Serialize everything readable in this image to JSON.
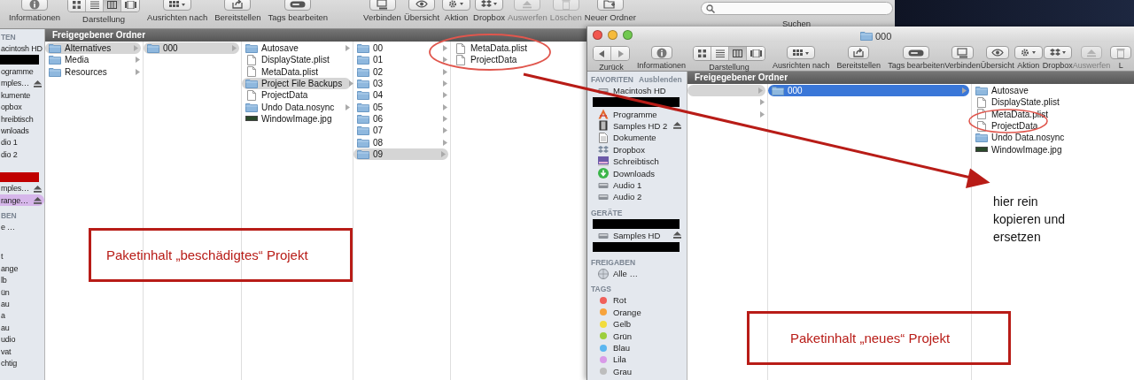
{
  "left_window": {
    "focused": false,
    "toolbar": {
      "left": [
        {
          "label": "Informationen",
          "kind": "info",
          "disabled": false
        },
        {
          "label": "Darstellung",
          "kind": "view",
          "disabled": false,
          "segments": [
            {
              "kind": "grid",
              "selected": false
            },
            {
              "kind": "list",
              "selected": false
            },
            {
              "kind": "columns",
              "selected": true
            },
            {
              "kind": "coverflow",
              "selected": false
            }
          ]
        },
        {
          "label": "Ausrichten nach",
          "kind": "arrange",
          "disabled": false
        },
        {
          "label": "Bereitstellen",
          "kind": "share",
          "disabled": false
        },
        {
          "label": "Tags bearbeiten",
          "kind": "tag",
          "disabled": false
        }
      ],
      "right": [
        {
          "label": "Verbinden",
          "kind": "connect",
          "disabled": false
        },
        {
          "label": "Übersicht",
          "kind": "eye",
          "disabled": false
        },
        {
          "label": "Aktion",
          "kind": "gear",
          "disabled": false
        },
        {
          "label": "Dropbox",
          "kind": "dropbox",
          "disabled": false
        },
        {
          "label": "Auswerfen",
          "kind": "eject",
          "disabled": true
        },
        {
          "label": "Löschen",
          "kind": "trash",
          "disabled": true
        },
        {
          "label": "Neuer Ordner",
          "kind": "newfolder",
          "disabled": false
        }
      ]
    },
    "search": {
      "label": "Suchen"
    },
    "path_bar": "Freigegebener Ordner",
    "sidebar": [
      {
        "title": "TEN",
        "items": [
          {
            "kind": "item",
            "label": "acintosh HD",
            "eject": false,
            "selected": false
          },
          {
            "kind": "redacted",
            "color": "#000000"
          },
          {
            "kind": "item",
            "label": "ogramme",
            "eject": false,
            "selected": false
          },
          {
            "kind": "item",
            "label": "mples…",
            "eject": true,
            "selected": false
          },
          {
            "kind": "item",
            "label": "kumente",
            "eject": false,
            "selected": false
          },
          {
            "kind": "item",
            "label": "opbox",
            "eject": false,
            "selected": false
          },
          {
            "kind": "item",
            "label": "hreibtisch",
            "eject": false,
            "selected": false
          },
          {
            "kind": "item",
            "label": "wnloads",
            "eject": false,
            "selected": false
          },
          {
            "kind": "item",
            "label": "dio 1",
            "eject": false,
            "selected": false
          },
          {
            "kind": "item",
            "label": "dio 2",
            "eject": false,
            "selected": false
          }
        ]
      },
      {
        "items": [
          {
            "kind": "redacted",
            "color": "#c00000"
          },
          {
            "kind": "item",
            "label": "mples…",
            "eject": true,
            "selected": false
          },
          {
            "kind": "item",
            "label": "range…",
            "eject": true,
            "selected": true
          }
        ]
      },
      {
        "title": "BEN",
        "items": [
          {
            "kind": "item",
            "label": "e …",
            "eject": false,
            "selected": false
          }
        ]
      },
      {
        "items": [
          {
            "kind": "item",
            "label": "t",
            "eject": false,
            "selected": false
          },
          {
            "kind": "item",
            "label": "ange",
            "eject": false,
            "selected": false
          },
          {
            "kind": "item",
            "label": "lb",
            "eject": false,
            "selected": false
          },
          {
            "kind": "item",
            "label": "ün",
            "eject": false,
            "selected": false
          },
          {
            "kind": "item",
            "label": "au",
            "eject": false,
            "selected": false
          },
          {
            "kind": "item",
            "label": "a",
            "eject": false,
            "selected": false
          },
          {
            "kind": "item",
            "label": "au",
            "eject": false,
            "selected": false
          },
          {
            "kind": "item",
            "label": "udio",
            "eject": false,
            "selected": false
          },
          {
            "kind": "item",
            "label": "vat",
            "eject": false,
            "selected": false
          },
          {
            "kind": "item",
            "label": "chtig",
            "eject": false,
            "selected": false
          }
        ]
      }
    ],
    "columns": [
      [
        {
          "kind": "folder",
          "label": "Alternatives",
          "arrow": true,
          "selected": true
        },
        {
          "kind": "folder",
          "label": "Media",
          "arrow": true,
          "selected": false
        },
        {
          "kind": "folder",
          "label": "Resources",
          "arrow": true,
          "selected": false
        }
      ],
      [
        {
          "kind": "folder",
          "label": "000",
          "arrow": true,
          "selected": true
        }
      ],
      [
        {
          "kind": "folder",
          "label": "Autosave",
          "arrow": true,
          "selected": false
        },
        {
          "kind": "file",
          "label": "DisplayState.plist",
          "arrow": false,
          "selected": false
        },
        {
          "kind": "file",
          "label": "MetaData.plist",
          "arrow": false,
          "selected": false
        },
        {
          "kind": "folder",
          "label": "Project File Backups",
          "arrow": true,
          "selected": true
        },
        {
          "kind": "file",
          "label": "ProjectData",
          "arrow": false,
          "selected": false
        },
        {
          "kind": "folder",
          "label": "Undo Data.nosync",
          "arrow": true,
          "selected": false
        },
        {
          "kind": "image",
          "label": "WindowImage.jpg",
          "arrow": false,
          "selected": false
        }
      ],
      [
        {
          "kind": "folder",
          "label": "00",
          "arrow": true,
          "selected": false
        },
        {
          "kind": "folder",
          "label": "01",
          "arrow": true,
          "selected": false
        },
        {
          "kind": "folder",
          "label": "02",
          "arrow": true,
          "selected": false
        },
        {
          "kind": "folder",
          "label": "03",
          "arrow": true,
          "selected": false
        },
        {
          "kind": "folder",
          "label": "04",
          "arrow": true,
          "selected": false
        },
        {
          "kind": "folder",
          "label": "05",
          "arrow": true,
          "selected": false
        },
        {
          "kind": "folder",
          "label": "06",
          "arrow": true,
          "selected": false
        },
        {
          "kind": "folder",
          "label": "07",
          "arrow": true,
          "selected": false
        },
        {
          "kind": "folder",
          "label": "08",
          "arrow": true,
          "selected": false
        },
        {
          "kind": "folder",
          "label": "09",
          "arrow": true,
          "selected": true
        }
      ],
      [
        {
          "kind": "file",
          "label": "MetaData.plist",
          "arrow": false,
          "selected": false
        },
        {
          "kind": "file",
          "label": "ProjectData",
          "arrow": false,
          "selected": false
        }
      ]
    ]
  },
  "right_window": {
    "focused": true,
    "title": "000",
    "toolbar": {
      "left": [
        {
          "label": "Zurück",
          "kind": "backforward",
          "disabled": false
        },
        {
          "label": "Informationen",
          "kind": "info",
          "disabled": false
        },
        {
          "label": "Darstellung",
          "kind": "view",
          "disabled": false,
          "segments": [
            {
              "kind": "grid",
              "selected": false
            },
            {
              "kind": "list",
              "selected": false
            },
            {
              "kind": "columns",
              "selected": true
            },
            {
              "kind": "coverflow",
              "selected": false
            }
          ]
        },
        {
          "label": "Ausrichten nach",
          "kind": "arrange",
          "disabled": false
        },
        {
          "label": "Bereitstellen",
          "kind": "share",
          "disabled": false
        },
        {
          "label": "Tags bearbeiten",
          "kind": "tag",
          "disabled": false
        }
      ],
      "right": [
        {
          "label": "Verbinden",
          "kind": "connect",
          "disabled": false
        },
        {
          "label": "Übersicht",
          "kind": "eye",
          "disabled": false
        },
        {
          "label": "Aktion",
          "kind": "gear",
          "disabled": false
        },
        {
          "label": "Dropbox",
          "kind": "dropbox",
          "disabled": false
        },
        {
          "label": "Auswerfen",
          "kind": "eject",
          "disabled": true
        },
        {
          "label": "L",
          "kind": "trash",
          "disabled": false
        }
      ]
    },
    "path_bar": "Freigegebener Ordner",
    "sidebar": [
      {
        "title": "FAVORITEN",
        "action": "Ausblenden",
        "items": [
          {
            "kind": "disk",
            "label": "Macintosh HD",
            "eject": false
          },
          {
            "kind": "redacted",
            "color": "#000000"
          },
          {
            "kind": "apps",
            "label": "Programme",
            "eject": false
          },
          {
            "kind": "drive",
            "label": "Samples HD 2",
            "eject": true
          },
          {
            "kind": "docs",
            "label": "Dokumente",
            "eject": false
          },
          {
            "kind": "dropbox",
            "label": "Dropbox",
            "eject": false
          },
          {
            "kind": "desktop",
            "label": "Schreibtisch",
            "eject": false
          },
          {
            "kind": "download",
            "label": "Downloads",
            "eject": false
          },
          {
            "kind": "disk",
            "label": "Audio 1",
            "eject": false
          },
          {
            "kind": "disk",
            "label": "Audio 2",
            "eject": false
          }
        ]
      },
      {
        "title": "GERÄTE",
        "items": [
          {
            "kind": "redacted",
            "color": "#000000"
          },
          {
            "kind": "disk",
            "label": "Samples HD",
            "eject": true
          },
          {
            "kind": "redacted",
            "color": "#000000"
          }
        ]
      },
      {
        "title": "FREIGABEN",
        "items": [
          {
            "kind": "network",
            "label": "Alle …",
            "eject": false
          }
        ]
      },
      {
        "title": "TAGS",
        "items": [
          {
            "kind": "tag",
            "label": "Rot",
            "color": "#f0605a",
            "eject": false
          },
          {
            "kind": "tag",
            "label": "Orange",
            "color": "#f7a33c",
            "eject": false
          },
          {
            "kind": "tag",
            "label": "Gelb",
            "color": "#f2dc3c",
            "eject": false
          },
          {
            "kind": "tag",
            "label": "Grün",
            "color": "#9ccf3c",
            "eject": false
          },
          {
            "kind": "tag",
            "label": "Blau",
            "color": "#5bb6f0",
            "eject": false
          },
          {
            "kind": "tag",
            "label": "Lila",
            "color": "#d99ae8",
            "eject": false
          },
          {
            "kind": "tag",
            "label": "Grau",
            "color": "#bdbdbd",
            "eject": false
          }
        ]
      }
    ],
    "columns": [
      [
        {
          "kind": "folder",
          "arrow": true,
          "selected": true
        },
        {
          "kind": "folder",
          "arrow": true,
          "selected": false
        },
        {
          "kind": "folder",
          "arrow": true,
          "selected": false
        }
      ],
      [
        {
          "kind": "folder",
          "label": "000",
          "arrow": true,
          "selected": true
        }
      ],
      [
        {
          "kind": "folder",
          "label": "Autosave",
          "arrow": false,
          "selected": false
        },
        {
          "kind": "file",
          "label": "DisplayState.plist",
          "arrow": false,
          "selected": false
        },
        {
          "kind": "file",
          "label": "MetaData.plist",
          "arrow": false,
          "selected": false
        },
        {
          "kind": "file",
          "label": "ProjectData",
          "arrow": false,
          "selected": false
        },
        {
          "kind": "folder",
          "label": "Undo Data.nosync",
          "arrow": false,
          "selected": false
        },
        {
          "kind": "image",
          "label": "WindowImage.jpg",
          "arrow": false,
          "selected": false
        }
      ]
    ]
  },
  "annotations": {
    "boxes": [
      "Paketinhalt „beschädigtes“ Projekt",
      "Paketinhalt „neues“ Projekt"
    ],
    "note": [
      "hier rein",
      "kopieren und",
      "ersetzen"
    ]
  }
}
